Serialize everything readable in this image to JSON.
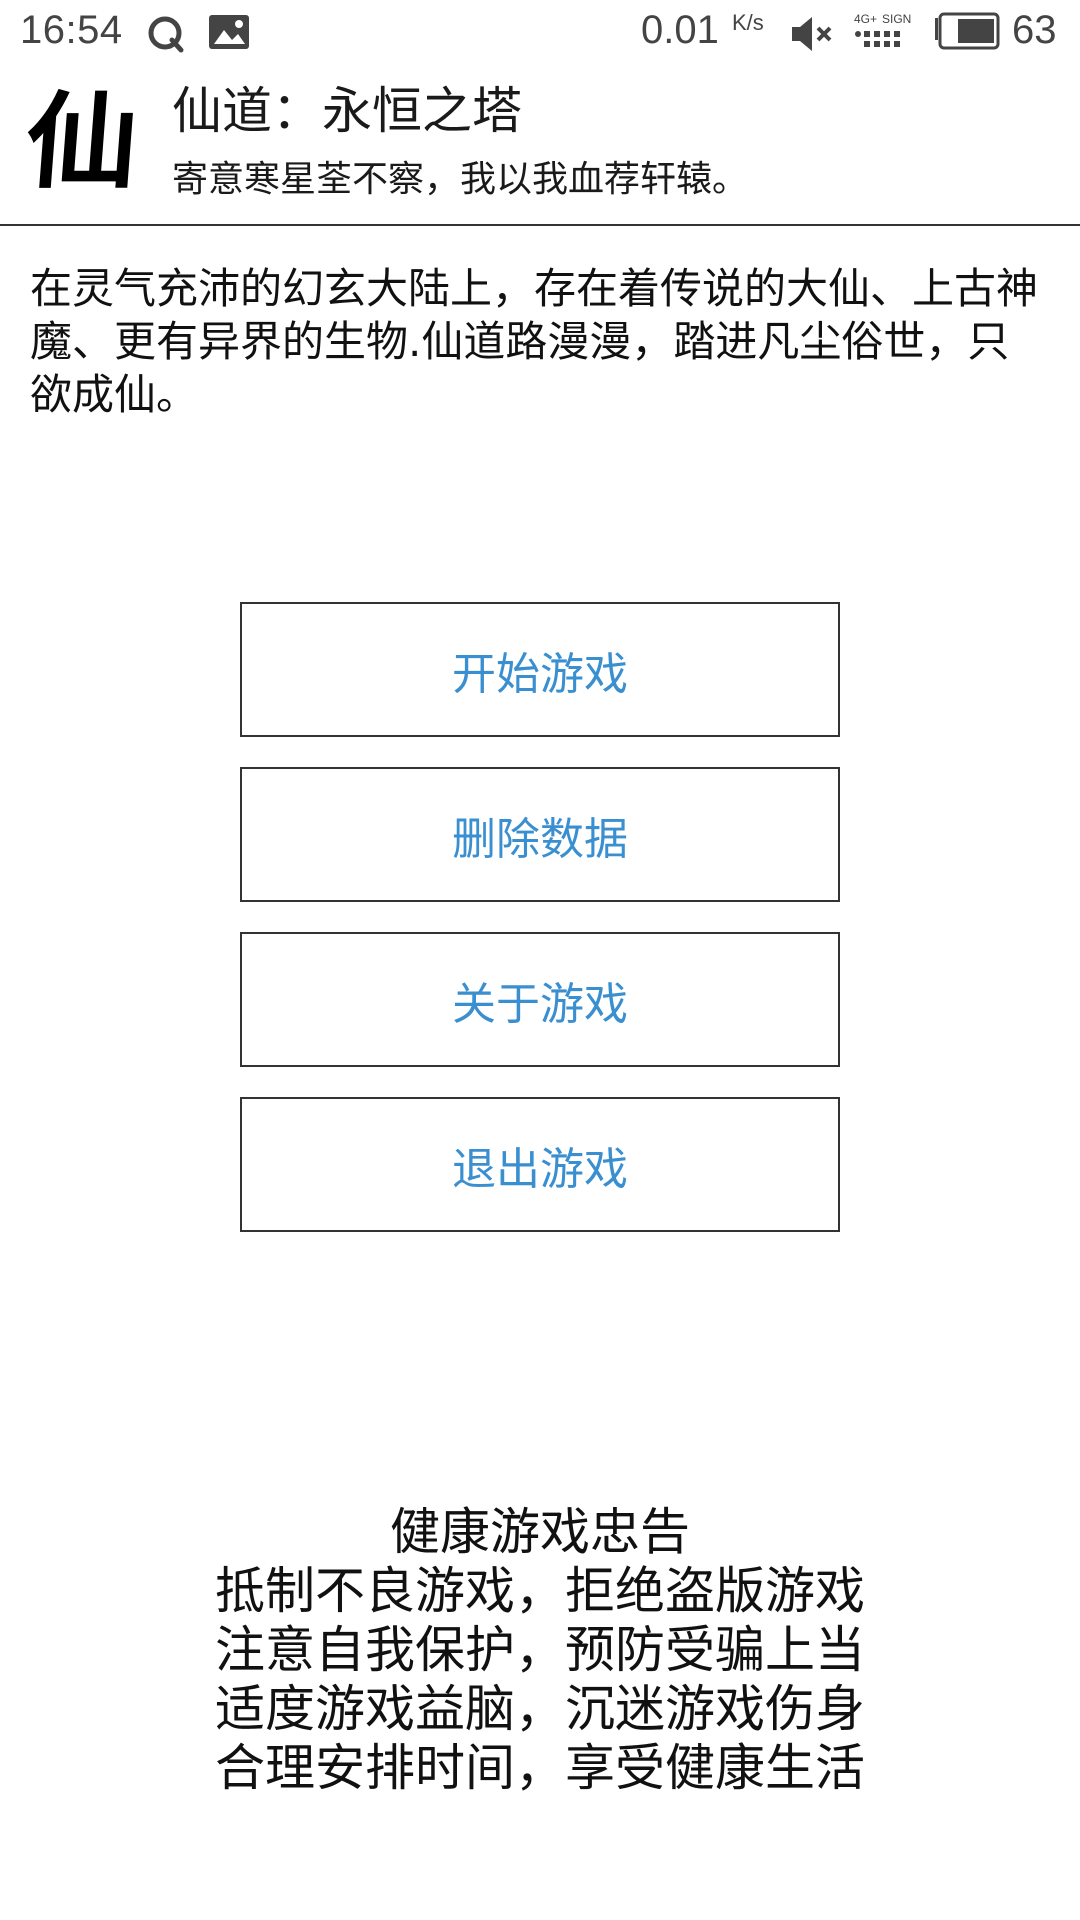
{
  "status_bar": {
    "time": "16:54",
    "icons": [
      "q-app-icon",
      "image-notification-icon",
      "mute-icon",
      "signal-4g-icon",
      "battery-icon"
    ],
    "net_speed": "0.01",
    "net_speed_unit": "K/s",
    "network_label": "4G+",
    "sign_label": "SIGN",
    "battery_level": "63"
  },
  "header": {
    "logo_char": "仙",
    "title": "仙道：永恒之塔",
    "subtitle": "寄意寒星荃不察，我以我血荐轩辕。"
  },
  "intro": {
    "text": "在灵气充沛的幻玄大陆上，存在着传说的大仙、上古神魔、更有异界的生物.仙道路漫漫，踏进凡尘俗世，只欲成仙。"
  },
  "menu": {
    "start_label": "开始游戏",
    "delete_label": "删除数据",
    "about_label": "关于游戏",
    "exit_label": "退出游戏"
  },
  "health_notice": {
    "title": "健康游戏忠告",
    "lines": [
      "抵制不良游戏，拒绝盗版游戏",
      "注意自我保护，预防受骗上当",
      "适度游戏益脑，沉迷游戏伤身",
      "合理安排时间，享受健康生活"
    ]
  },
  "colors": {
    "button_text": "#3a8fd0",
    "border": "#333333",
    "status_text": "#444444"
  }
}
